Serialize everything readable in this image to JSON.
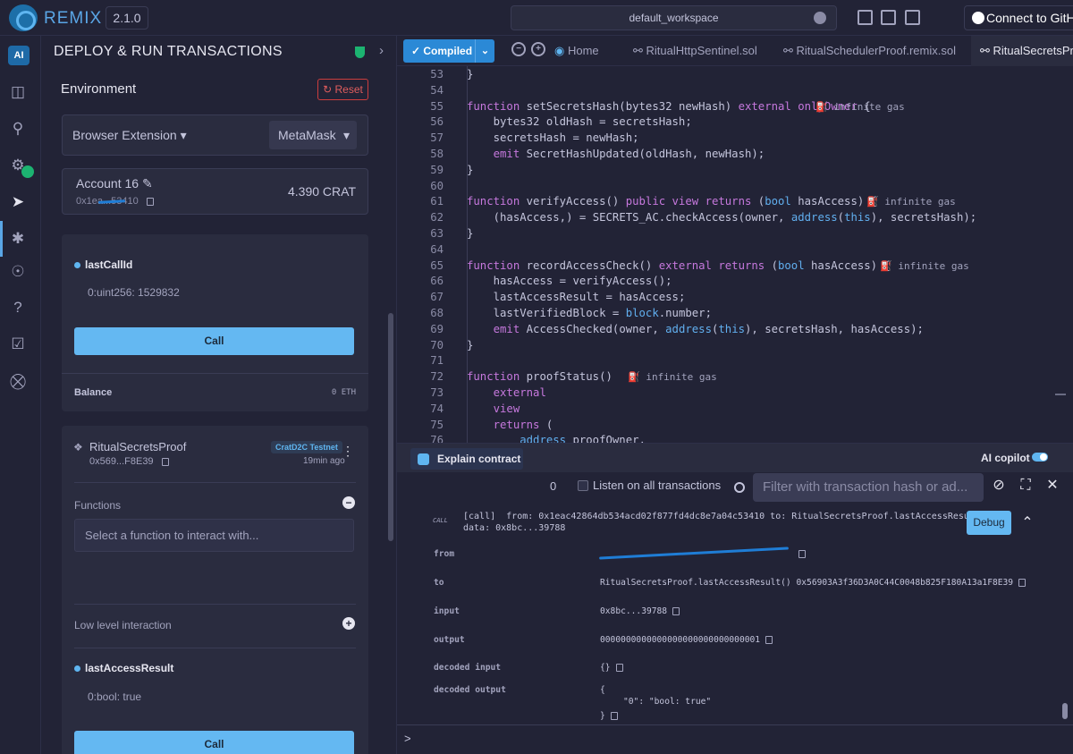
{
  "topbar": {
    "brand": "REMIX",
    "version": "2.1.0",
    "workspace": "default_workspace",
    "github_label": "Connect to GitHub"
  },
  "iconbar": {
    "ai_label": "AI",
    "items": [
      "file-explorer-icon",
      "search-icon",
      "solidity-compiler-icon",
      "deploy-icon",
      "debugger-icon",
      "git-icon",
      "help-icon",
      "checklist-icon",
      "plugin-manager-icon"
    ]
  },
  "panel": {
    "title": "DEPLOY & RUN TRANSACTIONS",
    "environment_label": "Environment",
    "reset_label": "Reset",
    "environment_value": "Browser Extension",
    "provider_value": "MetaMask",
    "account_name": "Account 16",
    "account_address": "0x1ea...53410",
    "account_balance": "4.390 CRAT",
    "last_call_id_label": "lastCallId",
    "last_call_id_value": "0:uint256: 1529832",
    "call_label": "Call",
    "balance_label": "Balance",
    "balance_value": "0 ETH",
    "contract_name": "RitualSecretsProof",
    "contract_address": "0x569...F8E39",
    "network_badge": "CratD2C Testnet",
    "deployed_time": "19min ago",
    "functions_label": "Functions",
    "function_placeholder": "Select a function to interact with...",
    "low_level_label": "Low level interaction",
    "last_access_label": "lastAccessResult",
    "last_access_value": "0:bool: true",
    "call_label_2": "Call"
  },
  "editor": {
    "compiled_label": "Compiled",
    "tabs": [
      "Home",
      "RitualHttpSentinel.sol",
      "RitualSchedulerProof.remix.sol",
      "RitualSecretsProof"
    ],
    "gas_label": "infinite gas",
    "lines": [
      {
        "n": "53",
        "html": "}"
      },
      {
        "n": "54",
        "html": ""
      },
      {
        "n": "55",
        "html": "function setSecretsHash(bytes32 newHash) external onlyOwner {"
      },
      {
        "n": "56",
        "html": "    bytes32 oldHash = secretsHash;"
      },
      {
        "n": "57",
        "html": "    secretsHash = newHash;"
      },
      {
        "n": "58",
        "html": "    emit SecretHashUpdated(oldHash, newHash);"
      },
      {
        "n": "59",
        "html": "}"
      },
      {
        "n": "60",
        "html": ""
      },
      {
        "n": "61",
        "html": "function verifyAccess() public view returns (bool hasAccess) {"
      },
      {
        "n": "62",
        "html": "    (hasAccess,) = SECRETS_AC.checkAccess(owner, address(this), secretsHash);"
      },
      {
        "n": "63",
        "html": "}"
      },
      {
        "n": "64",
        "html": ""
      },
      {
        "n": "65",
        "html": "function recordAccessCheck() external returns (bool hasAccess) {"
      },
      {
        "n": "66",
        "html": "    hasAccess = verifyAccess();"
      },
      {
        "n": "67",
        "html": "    lastAccessResult = hasAccess;"
      },
      {
        "n": "68",
        "html": "    lastVerifiedBlock = block.number;"
      },
      {
        "n": "69",
        "html": "    emit AccessChecked(owner, address(this), secretsHash, hasAccess);"
      },
      {
        "n": "70",
        "html": "}"
      },
      {
        "n": "71",
        "html": ""
      },
      {
        "n": "72",
        "html": "function proofStatus()"
      },
      {
        "n": "73",
        "html": "    external"
      },
      {
        "n": "74",
        "html": "    view"
      },
      {
        "n": "75",
        "html": "    returns ("
      },
      {
        "n": "76",
        "html": "        address proofOwner,"
      }
    ]
  },
  "terminal": {
    "explain_label": "Explain contract",
    "copilot_label": "AI copilot",
    "count": "0",
    "listen_label": "Listen on all transactions",
    "filter_placeholder": "Filter with transaction hash or ad...",
    "call_tag": "CALL",
    "call_line": "[call]  from: 0x1eac42864db534acd02f877fd4dc8e7a04c53410 to: RitualSecretsProof.lastAccessResult()",
    "data_line": "data: 0x8bc...39788",
    "debug_label": "Debug",
    "rows": [
      {
        "key": "from",
        "value": ""
      },
      {
        "key": "to",
        "value": "RitualSecretsProof.lastAccessResult() 0x56903A3f36D3A0C44C0048b825F180A13a1F8E39"
      },
      {
        "key": "input",
        "value": "0x8bc...39788"
      },
      {
        "key": "output",
        "value": "0000000000000000000000000000001"
      },
      {
        "key": "decoded input",
        "value": "{}"
      },
      {
        "key": "decoded output",
        "value": "{"
      }
    ],
    "decoded_output_body": "\"0\": \"bool: true\"",
    "decoded_output_close": "}",
    "prompt": ">"
  }
}
